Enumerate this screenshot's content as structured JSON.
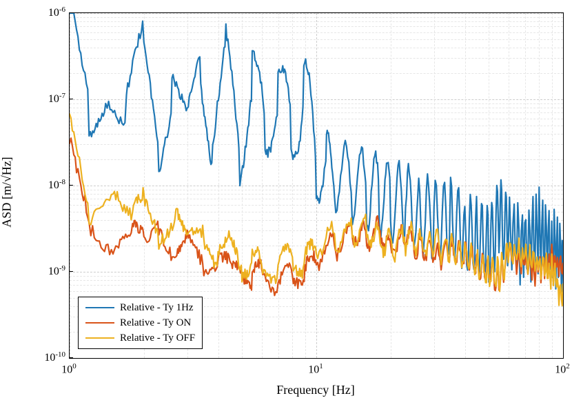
{
  "chart_data": {
    "type": "line",
    "xlabel": "Frequency [Hz]",
    "ylabel": "ASD [m/√Hz]",
    "xscale": "log",
    "yscale": "log",
    "xlim": [
      1,
      100
    ],
    "ylim": [
      1e-10,
      1e-06
    ],
    "x_ticks": [
      1,
      10,
      100
    ],
    "x_tick_labels": [
      "10⁰",
      "10¹",
      "10²"
    ],
    "y_ticks": [
      1e-10,
      1e-09,
      1e-08,
      1e-07,
      1e-06
    ],
    "y_tick_labels": [
      "10⁻¹⁰",
      "10⁻⁹",
      "10⁻⁸",
      "10⁻⁷",
      "10⁻⁶"
    ],
    "series": [
      {
        "name": "Relative - Ty 1Hz",
        "color": "#1f77b4",
        "x": [
          1,
          1.2,
          1.4,
          1.7,
          2,
          2.3,
          2.6,
          3,
          3.4,
          3.8,
          4.3,
          4.9,
          5.5,
          6.2,
          7,
          7.9,
          8.9,
          10,
          11,
          12,
          14,
          16,
          18,
          20,
          23,
          26,
          30,
          35,
          40,
          45,
          50,
          55,
          60,
          70,
          80,
          90,
          100
        ],
        "y": [
          1e-06,
          8e-08,
          2e-07,
          5e-08,
          3e-07,
          4e-08,
          2e-07,
          3e-08,
          3e-07,
          4e-08,
          2.5e-07,
          3e-08,
          2e-07,
          3e-08,
          2e-07,
          3e-08,
          1.5e-07,
          2e-08,
          1.5e-08,
          1.2e-08,
          1e-08,
          9e-09,
          8e-09,
          7e-09,
          6e-09,
          5e-09,
          4e-09,
          4e-09,
          3e-09,
          2.5e-09,
          2e-09,
          4e-09,
          3e-09,
          2e-09,
          3e-09,
          2e-09,
          1.5e-09
        ]
      },
      {
        "name": "Relative - Ty ON",
        "color": "#d95319",
        "x": [
          1,
          1.2,
          1.5,
          1.8,
          2,
          2.3,
          2.7,
          3,
          3.5,
          4,
          4.5,
          5,
          5.5,
          6,
          7,
          8,
          9,
          10,
          12,
          14,
          16,
          18,
          20,
          23,
          26,
          30,
          35,
          40,
          45,
          50,
          55,
          60,
          70,
          80,
          90,
          100
        ],
        "y": [
          3e-08,
          4e-09,
          2e-09,
          3e-09,
          2e-09,
          4e-09,
          1.5e-09,
          2e-09,
          1.2e-09,
          1.5e-09,
          1e-09,
          1.2e-09,
          8e-10,
          1e-09,
          7e-10,
          1e-09,
          9e-10,
          1.5e-09,
          2e-09,
          3e-09,
          2.5e-09,
          3e-09,
          2e-09,
          2.5e-09,
          2e-09,
          1.5e-09,
          1.8e-09,
          1.5e-09,
          1.2e-09,
          1e-09,
          8e-10,
          1.5e-09,
          1.2e-09,
          1e-09,
          1.5e-09,
          1e-09
        ]
      },
      {
        "name": "Relative - Ty OFF",
        "color": "#edb120",
        "x": [
          1,
          1.2,
          1.5,
          1.8,
          2,
          2.3,
          2.7,
          3,
          3.5,
          4,
          4.5,
          5,
          5.5,
          6,
          7,
          8,
          9,
          10,
          12,
          14,
          16,
          18,
          20,
          23,
          26,
          30,
          35,
          40,
          45,
          50,
          55,
          60,
          70,
          80,
          90,
          100
        ],
        "y": [
          5e-08,
          5e-09,
          1e-08,
          4e-09,
          6e-09,
          3e-09,
          5e-09,
          2e-09,
          3e-09,
          1.5e-09,
          2e-09,
          1.2e-09,
          1.5e-09,
          1e-09,
          1.2e-09,
          1.5e-09,
          1.2e-09,
          2e-09,
          2.5e-09,
          3e-09,
          3e-09,
          2.5e-09,
          2e-09,
          2.5e-09,
          2.2e-09,
          2e-09,
          1.8e-09,
          1.5e-09,
          1.2e-09,
          1e-09,
          9e-10,
          1.8e-09,
          1.5e-09,
          1.2e-09,
          1e-09,
          5e-10
        ]
      }
    ],
    "legend": {
      "position": "lower left",
      "entries": [
        "Relative - Ty 1Hz",
        "Relative - Ty ON",
        "Relative - Ty OFF"
      ]
    }
  }
}
